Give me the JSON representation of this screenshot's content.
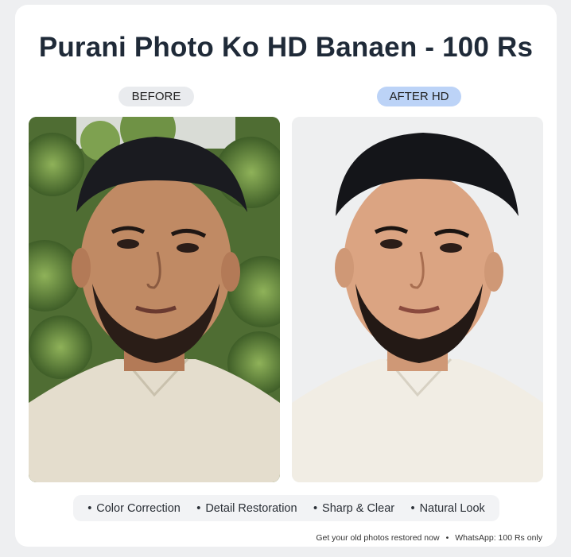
{
  "title": "Purani Photo Ko HD Banaen - 100 Rs",
  "labels": {
    "before": "BEFORE",
    "after": "AFTER HD"
  },
  "features": [
    "Color Correction",
    "Detail Restoration",
    "Sharp & Clear",
    "Natural Look"
  ],
  "footer": {
    "left": "Get your old photos restored now",
    "right": "WhatsApp: 100 Rs only"
  },
  "colors": {
    "title": "#1f2a38",
    "after_pill": "#bcd3f7",
    "before_pill": "#e9ebee",
    "foliage": "#5a7a3d"
  }
}
